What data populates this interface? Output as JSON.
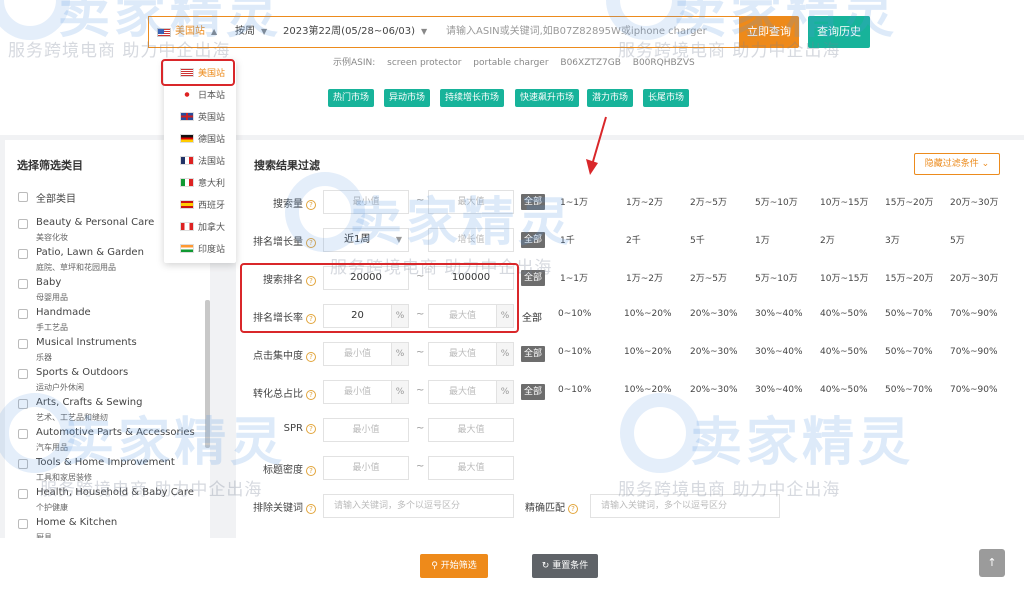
{
  "search": {
    "site": "美国站",
    "period_type": "按周",
    "period_value": "2023第22周(05/28~06/03)",
    "placeholder": "请输入ASIN或关键词,如B07Z82895W或iphone charger",
    "search_button": "立即查询",
    "history_button": "查询历史"
  },
  "examples": {
    "label": "示例ASIN:",
    "items": [
      "screen protector",
      "portable charger",
      "B06XZTZ7GB",
      "B00RQHBZVS"
    ]
  },
  "market_tags": [
    "热门市场",
    "异动市场",
    "持续增长市场",
    "快速飙升市场",
    "潜力市场",
    "长尾市场"
  ],
  "site_dropdown": [
    {
      "label": "美国站",
      "flag": "us-flag-icon"
    },
    {
      "label": "日本站",
      "flag": "jp-flag-icon"
    },
    {
      "label": "英国站",
      "flag": "uk-flag-icon"
    },
    {
      "label": "德国站",
      "flag": "de-flag-icon"
    },
    {
      "label": "法国站",
      "flag": "fr-flag-icon"
    },
    {
      "label": "意大利",
      "flag": "it-flag-icon"
    },
    {
      "label": "西班牙",
      "flag": "es-flag-icon"
    },
    {
      "label": "加拿大",
      "flag": "ca-flag-icon"
    },
    {
      "label": "印度站",
      "flag": "in-flag-icon"
    }
  ],
  "categories": {
    "title": "选择筛选类目",
    "items": [
      {
        "en": "全部类目",
        "cn": ""
      },
      {
        "en": "Beauty & Personal Care",
        "cn": "美容化妆"
      },
      {
        "en": "Patio, Lawn & Garden",
        "cn": "庭院、草坪和花园用品"
      },
      {
        "en": "Baby",
        "cn": "母婴用品"
      },
      {
        "en": "Handmade",
        "cn": "手工艺品"
      },
      {
        "en": "Musical Instruments",
        "cn": "乐器"
      },
      {
        "en": "Sports & Outdoors",
        "cn": "运动户外休闲"
      },
      {
        "en": "Arts, Crafts & Sewing",
        "cn": "艺术、工艺品和缝纫"
      },
      {
        "en": "Automotive Parts & Accessories",
        "cn": "汽车用品"
      },
      {
        "en": "Tools & Home Improvement",
        "cn": "工具和家居装修"
      },
      {
        "en": "Health, Household & Baby Care",
        "cn": "个护健康"
      },
      {
        "en": "Home & Kitchen",
        "cn": "厨具"
      }
    ]
  },
  "filters": {
    "title": "搜索结果过滤",
    "hide_button": "隐藏过滤条件",
    "min_placeholder": "最小值",
    "max_placeholder": "最大值",
    "all_label": "全部",
    "pct": "%",
    "tilde": "~",
    "rows": {
      "search_volume": {
        "label": "搜索量",
        "options": [
          "1~1万",
          "1万~2万",
          "2万~5万",
          "5万~10万",
          "10万~15万",
          "15万~20万",
          "20万~30万"
        ]
      },
      "rank_growth": {
        "label": "排名增长量",
        "select": "近1周",
        "max": "增长值",
        "options": [
          "1千",
          "2千",
          "5千",
          "1万",
          "2万",
          "3万",
          "5万"
        ]
      },
      "search_rank": {
        "label": "搜索排名",
        "min_value": "20000",
        "max_value": "100000",
        "options": [
          "1~1万",
          "1万~2万",
          "2万~5万",
          "5万~10万",
          "10万~15万",
          "15万~20万",
          "20万~30万"
        ]
      },
      "rank_growth_rate": {
        "label": "排名增长率",
        "min_value": "20",
        "options": [
          "0~10%",
          "10%~20%",
          "20%~30%",
          "30%~40%",
          "40%~50%",
          "50%~70%",
          "70%~90%"
        ]
      },
      "click_concentration": {
        "label": "点击集中度",
        "options": [
          "0~10%",
          "10%~20%",
          "20%~30%",
          "30%~40%",
          "40%~50%",
          "50%~70%",
          "70%~90%"
        ]
      },
      "conversion_share": {
        "label": "转化总占比",
        "options": [
          "0~10%",
          "10%~20%",
          "20%~30%",
          "30%~40%",
          "40%~50%",
          "50%~70%",
          "70%~90%"
        ]
      },
      "spr": {
        "label": "SPR"
      },
      "title_density": {
        "label": "标题密度"
      },
      "exclude_keywords": {
        "label": "排除关键词",
        "placeholder": "请输入关键词，多个以逗号区分"
      },
      "exact_match": {
        "label": "精确匹配",
        "placeholder": "请输入关键词，多个以逗号区分"
      }
    }
  },
  "footer": {
    "start_button": "开始筛选",
    "reset_button": "重置条件",
    "to_top": "↑"
  },
  "watermark": {
    "logo": "卖家精灵",
    "text": "服务跨境电商 助力中企出海"
  },
  "colors": {
    "orange": "#ee8a1a",
    "green": "#17b39a",
    "highlight_red": "#d9272a"
  }
}
